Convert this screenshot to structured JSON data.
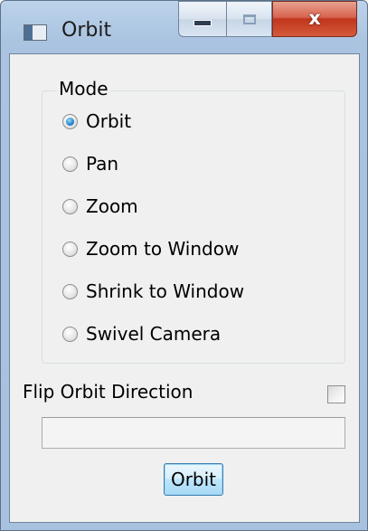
{
  "window": {
    "title": "Orbit",
    "close_glyph": "x",
    "icons": {
      "app": "window-app-icon",
      "minimize": "minimize-icon",
      "maximize": "maximize-icon",
      "close": "close-icon"
    }
  },
  "mode_group": {
    "label": "Mode",
    "selected": "Orbit",
    "options": [
      {
        "label": "Orbit",
        "checked": true
      },
      {
        "label": "Pan",
        "checked": false
      },
      {
        "label": "Zoom",
        "checked": false
      },
      {
        "label": "Zoom to Window",
        "checked": false
      },
      {
        "label": "Shrink to Window",
        "checked": false
      },
      {
        "label": "Swivel Camera",
        "checked": false
      }
    ]
  },
  "flip": {
    "label": "Flip Orbit Direction",
    "checked": false
  },
  "status_field": {
    "value": ""
  },
  "actions": {
    "orbit_label": "Orbit"
  },
  "colors": {
    "frame": "#a9c3e0",
    "client": "#f0f0f0",
    "close_button": "#c2351d",
    "radio_selected": "#2a8ad4",
    "button_border": "#3c7fb1"
  }
}
